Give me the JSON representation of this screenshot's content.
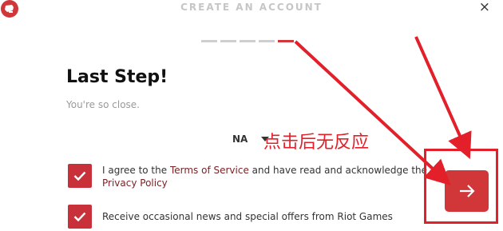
{
  "window": {
    "title": "CREATE AN ACCOUNT",
    "close_label": "×"
  },
  "progress": {
    "total": 5,
    "current": 5
  },
  "main": {
    "heading": "Last Step!",
    "subtext": "You're so close.",
    "region": "NA"
  },
  "annotation": {
    "text": "点击后无反应"
  },
  "agreements": {
    "terms_prefix": "I agree to the ",
    "terms_link": "Terms of Service",
    "terms_middle": " and have read and acknowledge the ",
    "privacy_link": "Privacy Policy",
    "news_text": "Receive occasional news and special offers from Riot Games"
  },
  "colors": {
    "accent": "#d13639",
    "annotation": "#e3202a",
    "link": "#7a2226"
  },
  "icons": {
    "logo": "riot-fist-icon",
    "next": "arrow-right-icon",
    "check": "checkmark-icon"
  }
}
